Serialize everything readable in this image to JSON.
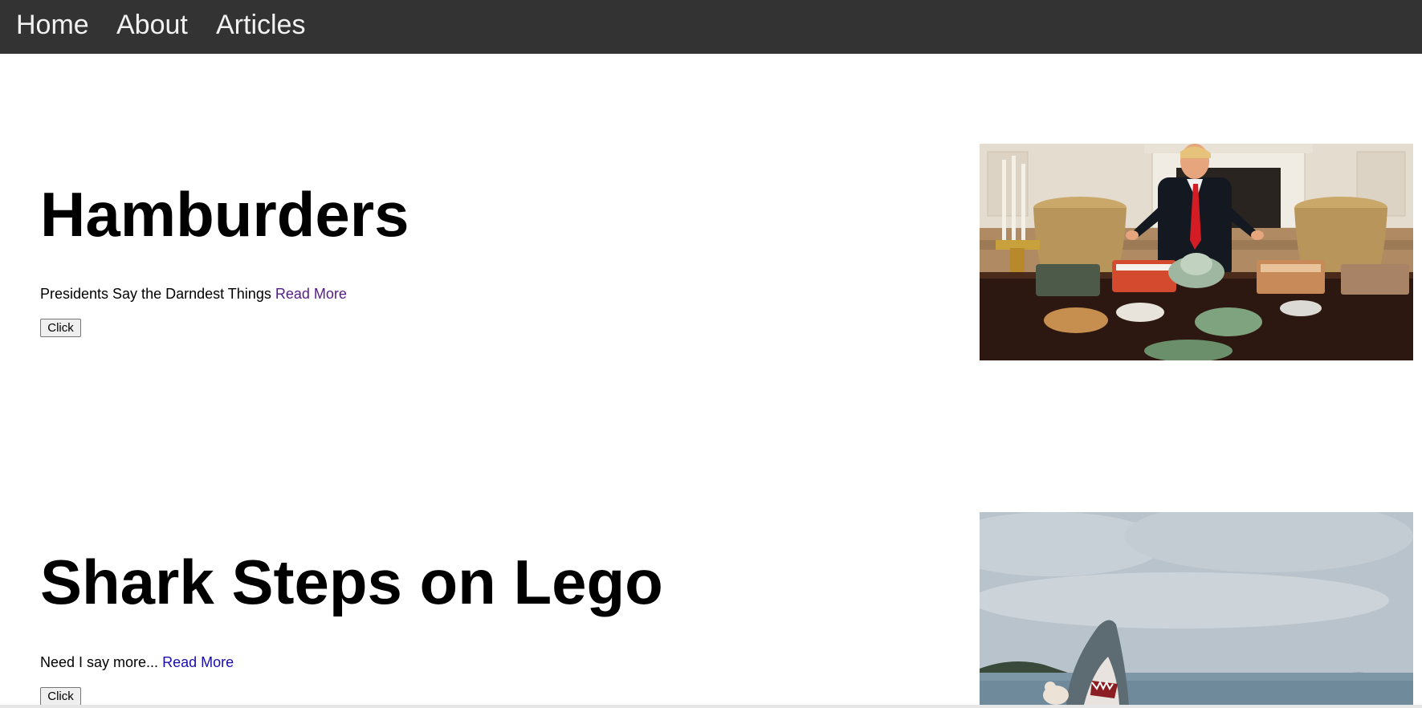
{
  "nav": {
    "items": [
      {
        "label": "Home"
      },
      {
        "label": "About"
      },
      {
        "label": "Articles"
      }
    ]
  },
  "articles": [
    {
      "title": "Hamburders",
      "description": "Presidents Say the Darndest Things",
      "link_label": "Read More",
      "button_label": "Click",
      "image_alt": "Photo of a president standing behind a table of fast food in a formal dining room"
    },
    {
      "title": "Shark Steps on Lego",
      "description": "Need I say more...",
      "link_label": "Read More",
      "button_label": "Click",
      "image_alt": "Photo of a shark rising out of a lake"
    }
  ],
  "colors": {
    "nav_background": "#333333",
    "nav_text": "#f2f2f2",
    "link_visited": "#551a8b",
    "link_unvisited": "#1a0dab"
  }
}
